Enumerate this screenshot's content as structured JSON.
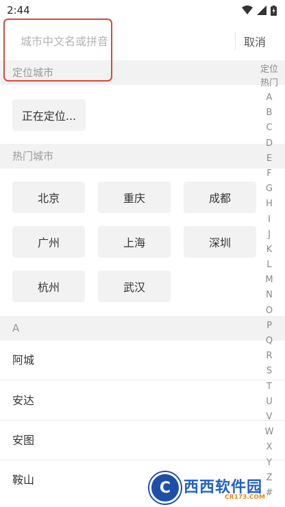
{
  "status_bar": {
    "time": "2:44"
  },
  "search": {
    "placeholder": "城市中文名或拼音",
    "cancel_label": "取消"
  },
  "location_section": {
    "header": "定位城市",
    "status": "正在定位..."
  },
  "hot_section": {
    "header": "热门城市",
    "cities": [
      "北京",
      "重庆",
      "成都",
      "广州",
      "上海",
      "深圳",
      "杭州",
      "武汉"
    ]
  },
  "list_section": {
    "header": "A",
    "cities": [
      "阿城",
      "安达",
      "安图",
      "鞍山"
    ]
  },
  "index_bar": [
    "定位",
    "热门",
    "A",
    "B",
    "C",
    "D",
    "E",
    "F",
    "G",
    "H",
    "I",
    "J",
    "K",
    "L",
    "M",
    "N",
    "O",
    "P",
    "Q",
    "R",
    "S",
    "T",
    "U",
    "V",
    "W",
    "X",
    "Y",
    "Z",
    "#"
  ],
  "watermark": {
    "brand": "西西软件园",
    "url": "CR173.COM"
  },
  "colors": {
    "highlight": "#d04a3b",
    "section_bg": "#f2f2f2",
    "chip_bg": "#f2f2f2"
  }
}
